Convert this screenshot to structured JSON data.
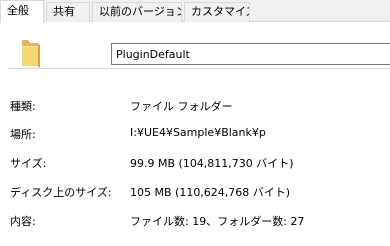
{
  "tabs": [
    {
      "label": "全般",
      "active": true
    },
    {
      "label": "共有",
      "active": false
    },
    {
      "label": "以前のバージョン",
      "active": false
    },
    {
      "label": "カスタマイズ",
      "active": false
    }
  ],
  "header": {
    "icon": "folder-icon",
    "name_value": "PluginDefault"
  },
  "properties": {
    "type_label": "種類:",
    "type_value": "ファイル フォルダー",
    "location_label": "場所:",
    "location_value": "I:¥UE4¥Sample¥Blank¥p",
    "size_label": "サイズ:",
    "size_value": "99.9 MB (104,811,730 バイト)",
    "disk_size_label": "ディスク上のサイズ:",
    "disk_size_value": "105 MB (110,624,768 バイト)",
    "contents_label": "内容:",
    "contents_value": "ファイル数: 19、フォルダー数: 27"
  },
  "colors": {
    "folder_back": "#E8B44C",
    "folder_front": "#F8D775",
    "separator": "#d9d9d9"
  }
}
